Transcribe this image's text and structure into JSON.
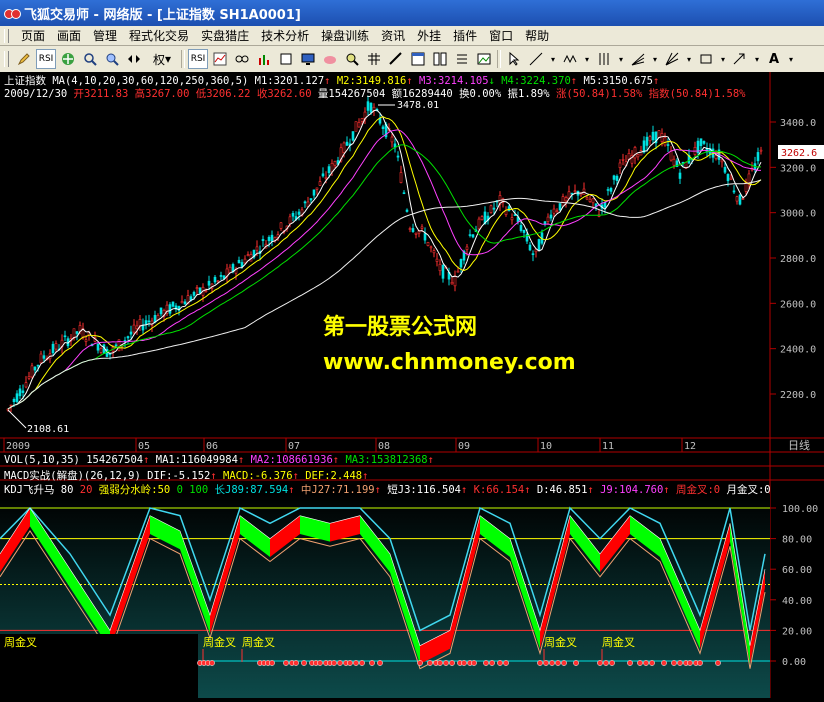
{
  "window": {
    "title": "飞狐交易师 - 网络版 - [上证指数 SH1A0001]"
  },
  "menu": [
    "页面",
    "画面",
    "管理",
    "程式化交易",
    "实盘猎庄",
    "技术分析",
    "操盘训练",
    "资讯",
    "外挂",
    "插件",
    "窗口",
    "帮助"
  ],
  "toolbar": {
    "right_label": "权"
  },
  "header": {
    "line1_name": "上证指数",
    "ma_params": "MA(4,10,20,30,60,120,250,360,5)",
    "m1": "M1:3201.127",
    "m2": "M2:3149.816",
    "m3": "M3:3214.105",
    "m4": "M4:3224.370",
    "m5": "M5:3150.675",
    "date": "2009/12/30",
    "open": "开3211.83",
    "high": "高3267.00",
    "low": "低3206.22",
    "close": "收3262.60",
    "volume": "量154267504",
    "amount": "额16289440",
    "turnover": "换0.00%",
    "amplitude": "振1.89%",
    "change": "涨(50.84)1.58%",
    "index": "指数(50.84)1.58%"
  },
  "price_panel": {
    "high_label": "3478.01",
    "low_label": "2108.61",
    "current_price": "3262.6",
    "y_ticks": [
      "3400.0",
      "3200.0",
      "3000.0",
      "2800.0",
      "2600.0",
      "2400.0",
      "2200.0"
    ],
    "x_ticks": [
      "2009",
      "05",
      "06",
      "07",
      "08",
      "09",
      "10",
      "11",
      "12"
    ],
    "period": "日线"
  },
  "watermark": {
    "line1": "第一股票公式网",
    "line2": "www.chnmoney.com"
  },
  "vol_line": {
    "name": "VOL(5,10,35)",
    "value": "154267504",
    "ma1": "MA1:116049984",
    "ma2": "MA2:108661936",
    "ma3": "MA3:153812368"
  },
  "macd_line": {
    "name": "MACD实战(解盘)(26,12,9)",
    "dif": "DIF:-5.152",
    "macd": "MACD:-6.376",
    "dea": "DEF:2.448"
  },
  "kdj_line": {
    "name": "KDJ飞升马",
    "n80": "80",
    "n20": "20",
    "ridge": "强弱分水岭:50",
    "n0": "0",
    "n100": "100",
    "long": "长J89:87.594",
    "mid": "中J27:71.199",
    "short": "短J3:116.504",
    "k": "K:66.154",
    "d": "D:46.851",
    "j9": "J9:104.760",
    "zhou": "周金叉:0",
    "yue": "月金叉:0"
  },
  "kdj_panel": {
    "y_ticks": [
      "100.00",
      "80.00",
      "60.00",
      "40.00",
      "20.00",
      "0.00"
    ],
    "cross_labels": [
      "周金叉",
      "周金叉",
      "周金叉",
      "周金叉"
    ],
    "left_label": "周金叉"
  },
  "colors": {
    "up": "#ff3030",
    "down": "#00e0e0",
    "bull": "#ff0000",
    "bear": "#00ff00",
    "axis": "#b00000"
  }
}
